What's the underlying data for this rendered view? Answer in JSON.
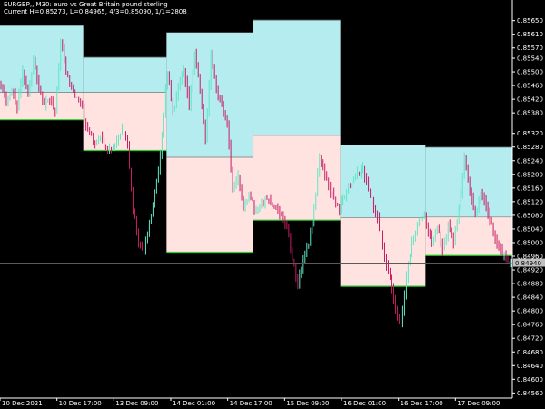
{
  "header": {
    "line1": "EURGBP,, M30:  euro vs Great Britain pound sterling",
    "line2": "Current H=0.85273, L=0.84965, 4/3=0.85090, 1/1=2808"
  },
  "colors": {
    "background": "#000000",
    "bull_candle": "#5fe6c5",
    "bear_candle": "#c71d63",
    "upper_box": "#b4ecef",
    "lower_box": "#ffe3e1",
    "box_bottom_line": "#26d02b",
    "grid_line": "#5a5a5a",
    "axis": "#ffffff"
  },
  "chart_data": {
    "type": "candlestick",
    "instrument": "EURGBP",
    "timeframe": "M30",
    "ylim": [
      0.84545,
      0.85705
    ],
    "y_ticks": [
      "0.85650",
      "0.85610",
      "0.85570",
      "0.85540",
      "0.85500",
      "0.85460",
      "0.85420",
      "0.85380",
      "0.85320",
      "0.85280",
      "0.85240",
      "0.85200",
      "0.85160",
      "0.85120",
      "0.85080",
      "0.85040",
      "0.85000",
      "0.84960",
      "0.84920",
      "0.84880",
      "0.84840",
      "0.84800",
      "0.84760",
      "0.84720",
      "0.84680",
      "0.84640",
      "0.84600",
      "0.84560"
    ],
    "x_labels": [
      "10 Dec 2021",
      "10 Dec 17:00",
      "13 Dec 09:00",
      "14 Dec 01:00",
      "14 Dec 17:00",
      "15 Dec 09:00",
      "16 Dec 01:00",
      "16 Dec 17:00",
      "17 Dec 09:00"
    ],
    "current_price": 0.8494,
    "current_price_label": "0.84940",
    "boxes": [
      {
        "start": 0,
        "end": 45,
        "high": 0.85636,
        "mid": 0.8544,
        "low": 0.8536
      },
      {
        "start": 46,
        "end": 91,
        "high": 0.85543,
        "mid": 0.8544,
        "low": 0.8527
      },
      {
        "start": 92,
        "end": 139,
        "high": 0.85616,
        "mid": 0.8525,
        "low": 0.84972
      },
      {
        "start": 140,
        "end": 187,
        "high": 0.85652,
        "mid": 0.85314,
        "low": 0.85066
      },
      {
        "start": 188,
        "end": 234,
        "high": 0.85286,
        "mid": 0.85073,
        "low": 0.84872
      },
      {
        "start": 235,
        "end": 282,
        "high": 0.8528,
        "mid": 0.85075,
        "low": 0.84962
      }
    ],
    "path": [
      [
        0,
        0.8547
      ],
      [
        3,
        0.8541
      ],
      [
        6,
        0.8545
      ],
      [
        9,
        0.854
      ],
      [
        12,
        0.855
      ],
      [
        15,
        0.8543
      ],
      [
        18,
        0.8554
      ],
      [
        21,
        0.8545
      ],
      [
        24,
        0.854
      ],
      [
        27,
        0.8542
      ],
      [
        30,
        0.8538
      ],
      [
        33,
        0.856
      ],
      [
        36,
        0.855
      ],
      [
        39,
        0.8545
      ],
      [
        42,
        0.8542
      ],
      [
        45,
        0.854
      ],
      [
        46,
        0.8535
      ],
      [
        49,
        0.8532
      ],
      [
        52,
        0.8529
      ],
      [
        55,
        0.8531
      ],
      [
        58,
        0.8528
      ],
      [
        61,
        0.8527
      ],
      [
        64,
        0.853
      ],
      [
        67,
        0.8533
      ],
      [
        70,
        0.8528
      ],
      [
        73,
        0.851
      ],
      [
        76,
        0.85
      ],
      [
        79,
        0.8498
      ],
      [
        82,
        0.8505
      ],
      [
        85,
        0.8515
      ],
      [
        88,
        0.8525
      ],
      [
        91,
        0.8545
      ],
      [
        92,
        0.855
      ],
      [
        95,
        0.8538
      ],
      [
        98,
        0.8545
      ],
      [
        101,
        0.855
      ],
      [
        104,
        0.854
      ],
      [
        107,
        0.8555
      ],
      [
        110,
        0.8545
      ],
      [
        113,
        0.853
      ],
      [
        116,
        0.8555
      ],
      [
        119,
        0.8545
      ],
      [
        122,
        0.854
      ],
      [
        125,
        0.8535
      ],
      [
        128,
        0.8515
      ],
      [
        131,
        0.852
      ],
      [
        134,
        0.851
      ],
      [
        137,
        0.8513
      ],
      [
        139,
        0.8512
      ],
      [
        140,
        0.8509
      ],
      [
        143,
        0.851
      ],
      [
        146,
        0.8513
      ],
      [
        149,
        0.8512
      ],
      [
        152,
        0.851
      ],
      [
        155,
        0.8508
      ],
      [
        158,
        0.8505
      ],
      [
        161,
        0.8495
      ],
      [
        164,
        0.8488
      ],
      [
        167,
        0.8495
      ],
      [
        170,
        0.85
      ],
      [
        173,
        0.851
      ],
      [
        176,
        0.8525
      ],
      [
        179,
        0.852
      ],
      [
        182,
        0.8515
      ],
      [
        185,
        0.8512
      ],
      [
        187,
        0.851
      ],
      [
        188,
        0.8512
      ],
      [
        191,
        0.8515
      ],
      [
        194,
        0.8518
      ],
      [
        197,
        0.852
      ],
      [
        200,
        0.8522
      ],
      [
        203,
        0.8515
      ],
      [
        206,
        0.851
      ],
      [
        209,
        0.8505
      ],
      [
        212,
        0.8495
      ],
      [
        215,
        0.849
      ],
      [
        218,
        0.848
      ],
      [
        221,
        0.8475
      ],
      [
        224,
        0.849
      ],
      [
        227,
        0.85
      ],
      [
        230,
        0.8505
      ],
      [
        234,
        0.8508
      ],
      [
        235,
        0.8505
      ],
      [
        238,
        0.85
      ],
      [
        241,
        0.8505
      ],
      [
        244,
        0.8498
      ],
      [
        247,
        0.8505
      ],
      [
        250,
        0.85
      ],
      [
        253,
        0.851
      ],
      [
        256,
        0.8525
      ],
      [
        259,
        0.8515
      ],
      [
        262,
        0.8508
      ],
      [
        265,
        0.8515
      ],
      [
        268,
        0.851
      ],
      [
        271,
        0.8505
      ],
      [
        274,
        0.85
      ],
      [
        277,
        0.8497
      ],
      [
        280,
        0.8495
      ],
      [
        282,
        0.8494
      ]
    ]
  }
}
